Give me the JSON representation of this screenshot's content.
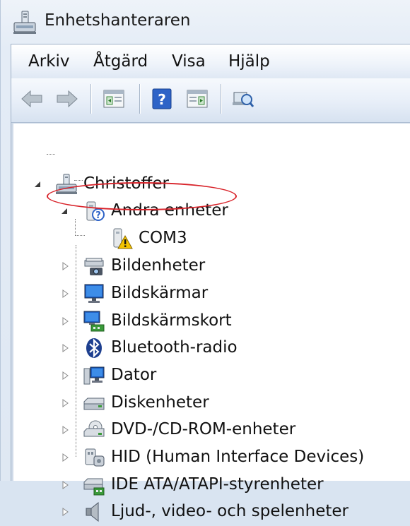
{
  "window": {
    "title": "Enhetshanteraren"
  },
  "menu": [
    "Arkiv",
    "Åtgärd",
    "Visa",
    "Hjälp"
  ],
  "toolbar": {
    "buttons": [
      "back-arrow-icon",
      "forward-arrow-icon",
      "show-hide-console-tree-icon",
      "help-icon",
      "show-hide-action-pane-icon",
      "scan-hardware-changes-icon"
    ]
  },
  "tree": {
    "root": {
      "label": "Christoffer"
    },
    "other_devices": {
      "label": "Andra enheter"
    },
    "com3": {
      "label": "COM3",
      "status": "warning"
    },
    "categories": [
      "Bildenheter",
      "Bildskärmar",
      "Bildskärmskort",
      "Bluetooth-radio",
      "Dator",
      "Diskenheter",
      "DVD-/CD-ROM-enheter",
      "HID (Human Interface Devices)",
      "IDE ATA/ATAPI-styrenheter",
      "Ljud-, video- och spelenheter"
    ]
  },
  "colors": {
    "highlight_ellipse": "#d8232a",
    "warning": "#f2c200",
    "selection": "#3d7bd9"
  }
}
